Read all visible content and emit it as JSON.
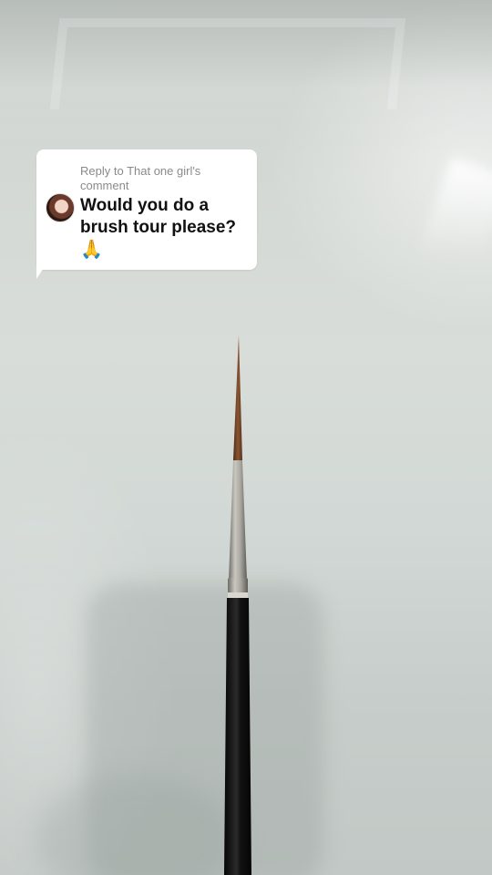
{
  "reply_sticker": {
    "header": "Reply to That one girl's comment",
    "comment": "Would you do a brush tour please?",
    "emoji": "🙏"
  },
  "icons": {
    "avatar": "user-avatar",
    "emoji": "folded-hands-icon"
  },
  "colors": {
    "bubble_background": "#ffffff",
    "header_text": "#8a8a8a",
    "comment_text": "#111111",
    "brush_handle": "#141414",
    "brush_ferrule": "#9a9892",
    "brush_bristles": "#7a4a2a"
  }
}
